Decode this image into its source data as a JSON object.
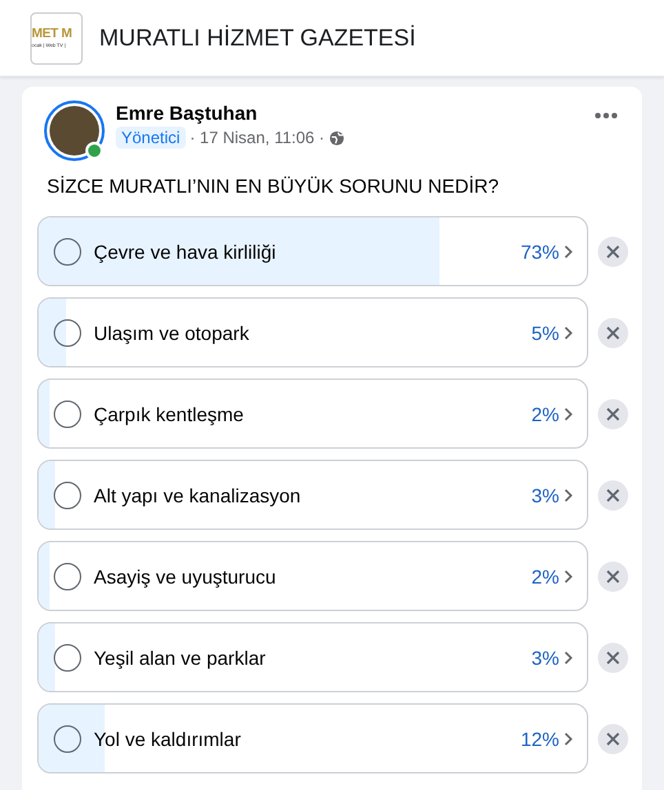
{
  "page": {
    "name": "MURATLI HİZMET GAZETESİ",
    "logo_text": "MET M",
    "logo_subtext": "ocak | Web TV |"
  },
  "post": {
    "author": "Emre Baştuhan",
    "online": true,
    "role": "Yönetici",
    "meta": "· 17 Nisan, 11:06 ·",
    "question": "SİZCE MURATLI’NIN EN BÜYÜK SORUNU NEDİR?",
    "options": [
      {
        "label": "Çevre ve hava kirliliği",
        "percent": "73%",
        "level": 0.73,
        "selected": false
      },
      {
        "label": "Ulaşım ve otopark",
        "percent": "5%",
        "level": 0.05,
        "selected": false
      },
      {
        "label": "Çarpık kentleşme",
        "percent": "2%",
        "level": 0.02,
        "selected": false
      },
      {
        "label": "Alt yapı ve kanalizasyon",
        "percent": "3%",
        "level": 0.03,
        "selected": false
      },
      {
        "label": "Asayiş ve uyuşturucu",
        "percent": "2%",
        "level": 0.02,
        "selected": false
      },
      {
        "label": "Yeşil alan ve parklar",
        "percent": "3%",
        "level": 0.03,
        "selected": false
      },
      {
        "label": "Yol ve kaldırımlar",
        "percent": "12%",
        "level": 0.12,
        "selected": false
      }
    ]
  }
}
